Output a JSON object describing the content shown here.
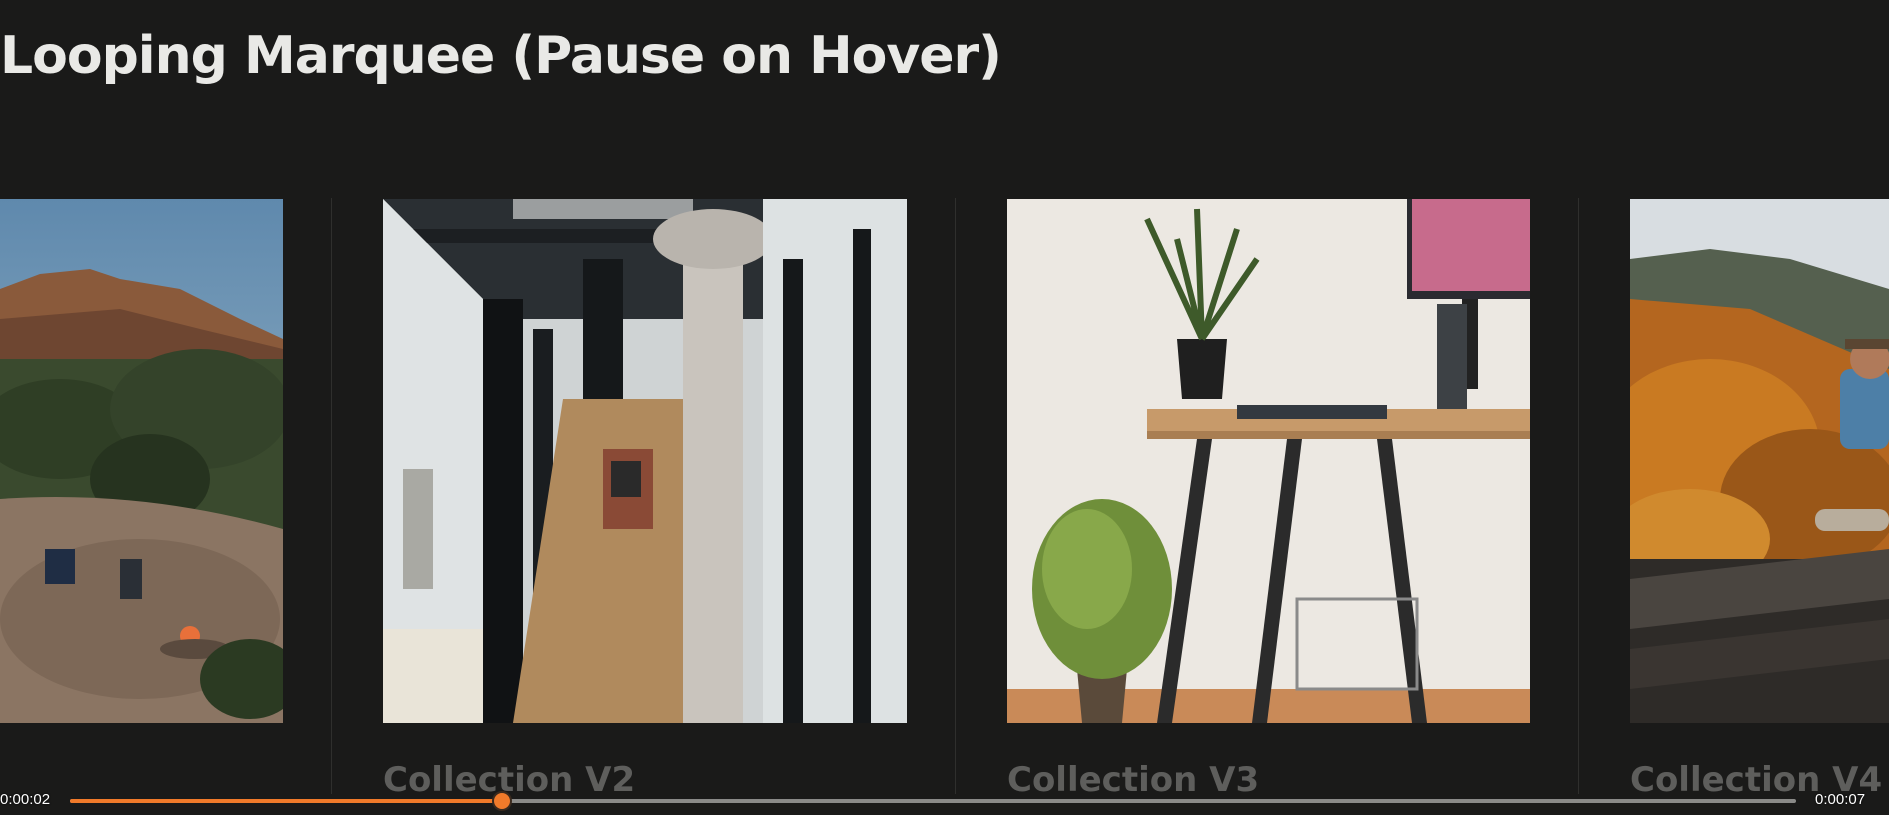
{
  "heading": "Looping Marquee (Pause on Hover)",
  "cards": [
    {
      "label": "",
      "image": "desert-campsite-photo"
    },
    {
      "label": "Collection V2",
      "image": "office-hallway-photo"
    },
    {
      "label": "Collection V3",
      "image": "standing-desk-plants-photo"
    },
    {
      "label": "Collection V4",
      "image": "mountain-hiker-photo"
    }
  ],
  "player": {
    "current_time": "0:00:02",
    "total_time": "0:00:07",
    "progress": 0.25,
    "accent_color": "#f07a2a"
  }
}
